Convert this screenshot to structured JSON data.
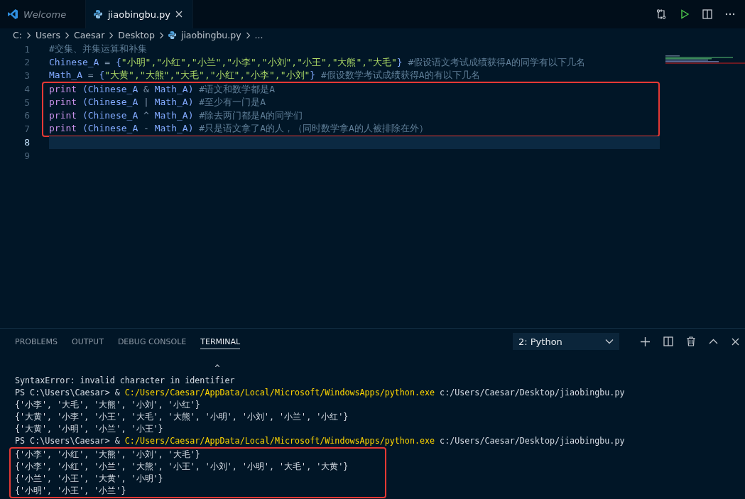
{
  "tabs": [
    {
      "label": "Welcome",
      "kind": "welcome",
      "selected": false
    },
    {
      "label": "jiaobingbu.py",
      "kind": "python",
      "selected": true
    }
  ],
  "breadcrumb": [
    {
      "label": "C:",
      "kind": "folder"
    },
    {
      "label": "Users",
      "kind": "folder"
    },
    {
      "label": "Caesar",
      "kind": "folder"
    },
    {
      "label": "Desktop",
      "kind": "folder"
    },
    {
      "label": "jiaobingbu.py",
      "kind": "python"
    },
    {
      "label": "...",
      "kind": "more"
    }
  ],
  "editor": {
    "lines": [
      {
        "number": "1",
        "current": false,
        "boxed": false,
        "tokens": [
          {
            "kind": "comment",
            "text": "#交集、并集运算和补集"
          }
        ]
      },
      {
        "number": "2",
        "current": false,
        "boxed": false,
        "tokens": [
          {
            "kind": "ident",
            "text": "Chinese_A"
          },
          {
            "kind": "op",
            "text": " = "
          },
          {
            "kind": "punct",
            "text": "{"
          },
          {
            "kind": "string",
            "text": "\"小明\",\"小红\",\"小兰\",\"小李\",\"小刘\",\"小王\",\"大熊\",\"大毛\""
          },
          {
            "kind": "punct",
            "text": "}"
          },
          {
            "kind": "comment",
            "text": " #假设语文考试成绩获得A的同学有以下几名"
          }
        ]
      },
      {
        "number": "3",
        "current": false,
        "boxed": false,
        "tokens": [
          {
            "kind": "ident",
            "text": "Math_A"
          },
          {
            "kind": "op",
            "text": " = "
          },
          {
            "kind": "punct",
            "text": "{"
          },
          {
            "kind": "string",
            "text": "\"大黄\",\"大熊\",\"大毛\",\"小红\",\"小李\",\"小刘\""
          },
          {
            "kind": "punct",
            "text": "}"
          },
          {
            "kind": "comment",
            "text": " #假设数学考试成绩获得A的有以下几名"
          }
        ]
      },
      {
        "number": "4",
        "current": false,
        "boxed": true,
        "tokens": [
          {
            "kind": "keyword",
            "text": "print"
          },
          {
            "kind": "ident",
            "text": " (Chinese_A "
          },
          {
            "kind": "op",
            "text": "&"
          },
          {
            "kind": "ident",
            "text": " Math_A) "
          },
          {
            "kind": "comment",
            "text": "#语文和数学都是A"
          }
        ]
      },
      {
        "number": "5",
        "current": false,
        "boxed": true,
        "tokens": [
          {
            "kind": "keyword",
            "text": "print"
          },
          {
            "kind": "ident",
            "text": " (Chinese_A "
          },
          {
            "kind": "op",
            "text": "|"
          },
          {
            "kind": "ident",
            "text": " Math_A) "
          },
          {
            "kind": "comment",
            "text": "#至少有一门是A"
          }
        ]
      },
      {
        "number": "6",
        "current": false,
        "boxed": true,
        "tokens": [
          {
            "kind": "keyword",
            "text": "print"
          },
          {
            "kind": "ident",
            "text": " (Chinese_A "
          },
          {
            "kind": "op",
            "text": "^"
          },
          {
            "kind": "ident",
            "text": " Math_A) "
          },
          {
            "kind": "comment",
            "text": "#除去两门都是A的同学们"
          }
        ]
      },
      {
        "number": "7",
        "current": false,
        "boxed": true,
        "tokens": [
          {
            "kind": "keyword",
            "text": "print"
          },
          {
            "kind": "ident",
            "text": " (Chinese_A "
          },
          {
            "kind": "op",
            "text": "-"
          },
          {
            "kind": "ident",
            "text": " Math_A) "
          },
          {
            "kind": "comment",
            "text": "#只是语文拿了A的人，（同时数学拿A的人被排除在外）"
          }
        ]
      },
      {
        "number": "8",
        "current": true,
        "boxed": false
      },
      {
        "number": "9",
        "current": false,
        "boxed": false
      }
    ]
  },
  "panel": {
    "tabs": [
      {
        "label": "PROBLEMS",
        "selected": false
      },
      {
        "label": "OUTPUT",
        "selected": false
      },
      {
        "label": "DEBUG CONSOLE",
        "selected": false
      },
      {
        "label": "TERMINAL",
        "selected": true
      }
    ],
    "terminal_select": "2: Python",
    "terminal": [
      {
        "kind": "plain",
        "boxed": false,
        "text": "                                        ^"
      },
      {
        "kind": "plain",
        "boxed": false,
        "text": "SyntaxError: invalid character in identifier"
      },
      {
        "kind": "command",
        "boxed": false,
        "prompt": "PS C:\\Users\\Caesar> & ",
        "exe": "C:/Users/Caesar/AppData/Local/Microsoft/WindowsApps/python.exe",
        "arg": " c:/Users/Caesar/Desktop/jiaobingbu.py"
      },
      {
        "kind": "plain",
        "boxed": false,
        "text": "{'小李', '大毛', '大熊', '小刘', '小红'}"
      },
      {
        "kind": "plain",
        "boxed": false,
        "text": "{'大黄', '小李', '小王', '大毛', '大熊', '小明', '小刘', '小兰', '小红'}"
      },
      {
        "kind": "plain",
        "boxed": false,
        "text": "{'大黄', '小明', '小兰', '小王'}"
      },
      {
        "kind": "command",
        "boxed": false,
        "prompt": "PS C:\\Users\\Caesar> & ",
        "exe": "C:/Users/Caesar/AppData/Local/Microsoft/WindowsApps/python.exe",
        "arg": " c:/Users/Caesar/Desktop/jiaobingbu.py"
      },
      {
        "kind": "plain",
        "boxed": true,
        "text": "{'小李', '小红', '大熊', '小刘', '大毛'}"
      },
      {
        "kind": "plain",
        "boxed": true,
        "text": "{'小李', '小红', '小兰', '大熊', '小王', '小刘', '小明', '大毛', '大黄'}"
      },
      {
        "kind": "plain",
        "boxed": true,
        "text": "{'小兰', '小王', '大黄', '小明'}"
      },
      {
        "kind": "plain",
        "boxed": true,
        "text": "{'小明', '小王', '小兰'}"
      }
    ]
  }
}
